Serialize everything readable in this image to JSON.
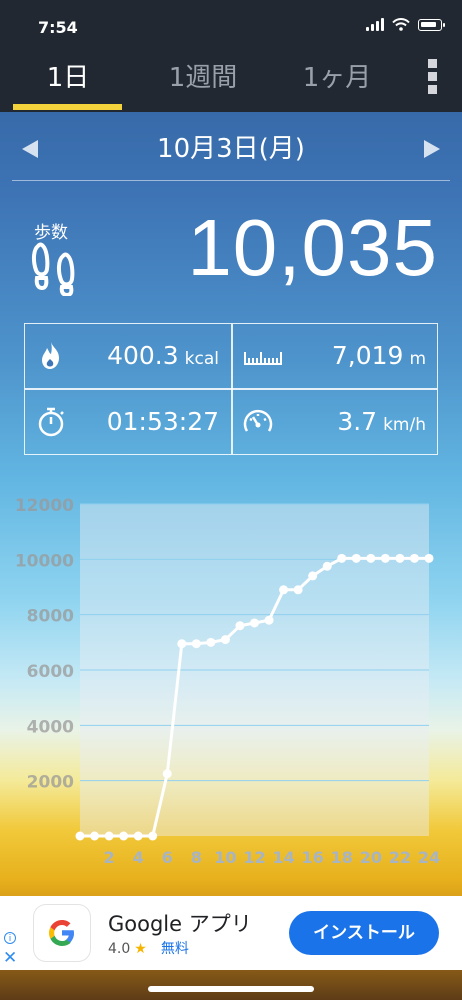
{
  "status": {
    "time": "7:54"
  },
  "tabs": [
    {
      "label": "1日",
      "active": true
    },
    {
      "label": "1週間",
      "active": false
    },
    {
      "label": "1ヶ月",
      "active": false
    }
  ],
  "date": {
    "label": "10月3日(月)"
  },
  "steps": {
    "label": "歩数",
    "value": "10,035"
  },
  "metrics": {
    "calories": {
      "value": "400.3",
      "unit": "kcal",
      "icon": "fire-icon"
    },
    "distance": {
      "value": "7,019",
      "unit": "m",
      "icon": "ruler-icon"
    },
    "duration": {
      "value": "01:53:27",
      "icon": "stopwatch-icon"
    },
    "speed": {
      "value": "3.7",
      "unit": "km/h",
      "icon": "speedometer-icon"
    }
  },
  "chart_data": {
    "type": "line",
    "x": [
      0,
      1,
      2,
      3,
      4,
      5,
      6,
      7,
      8,
      9,
      10,
      11,
      12,
      13,
      14,
      15,
      16,
      17,
      18,
      19,
      20,
      21,
      22,
      23,
      24
    ],
    "values": [
      0,
      0,
      0,
      0,
      0,
      0,
      2250,
      6950,
      6950,
      7000,
      7100,
      7600,
      7700,
      7800,
      8900,
      8900,
      9400,
      9750,
      10035,
      10035,
      10035,
      10035,
      10035,
      10035,
      10035
    ],
    "xticks": [
      "2",
      "4",
      "6",
      "8",
      "10",
      "12",
      "14",
      "16",
      "18",
      "20",
      "22",
      "24"
    ],
    "yticks": [
      "2000",
      "4000",
      "6000",
      "8000",
      "10000",
      "12000"
    ],
    "ylim": [
      0,
      12000
    ],
    "xlim": [
      0,
      24
    ],
    "grid": true,
    "colors": {
      "line": "#ffffff",
      "area": "#e8eef3",
      "grid": "#8fd0ee"
    }
  },
  "ad": {
    "title": "Google アプリ",
    "rating": "4.0",
    "price": "無料",
    "install_label": "インストール",
    "info_icon": "info-icon",
    "close_icon": "close-icon"
  }
}
